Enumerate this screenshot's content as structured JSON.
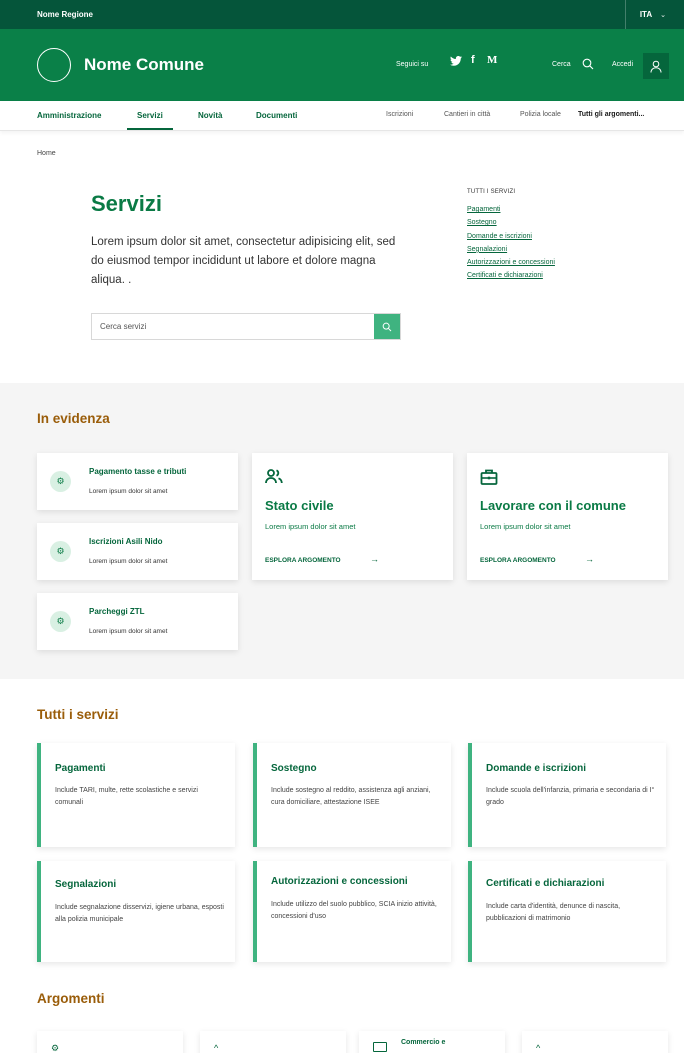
{
  "top_bar": {
    "region": "Nome Regione",
    "language": "ITA"
  },
  "header": {
    "title": "Nome Comune",
    "follow_label": "Seguici su",
    "social": [
      "twitter-icon",
      "facebook-icon",
      "medium-icon"
    ],
    "search_label": "Cerca",
    "login_label": "Accedi"
  },
  "nav": {
    "main": [
      "Amministrazione",
      "Servizi",
      "Novità",
      "Documenti"
    ],
    "active": "Servizi",
    "secondary": [
      "Iscrizioni",
      "Cantieri in città",
      "Polizia locale"
    ],
    "all_topics": "Tutti gli argomenti..."
  },
  "breadcrumb": {
    "home": "Home"
  },
  "hero": {
    "title": "Servizi",
    "description": "Lorem ipsum dolor sit amet, consectetur adipisicing elit, sed do eiusmod tempor incididunt ut labore et dolore magna aliqua. .",
    "search_placeholder": "Cerca servizi"
  },
  "side_menu": {
    "heading": "TUTTI I SERVIZI",
    "links": [
      "Pagamenti",
      "Sostegno",
      "Domande e iscrizioni",
      "Segnalazioni",
      "Autorizzazioni e concessioni",
      "Certificati e dichiarazioni"
    ]
  },
  "highlights": {
    "title": "In evidenza",
    "small_cards": [
      {
        "title": "Pagamento tasse e tributi",
        "desc": "Lorem ipsum dolor sit amet"
      },
      {
        "title": "Iscrizioni Asili Nido",
        "desc": "Lorem ipsum dolor sit amet"
      },
      {
        "title": "Parcheggi ZTL",
        "desc": "Lorem ipsum dolor sit amet"
      }
    ],
    "big_cards": [
      {
        "title": "Stato civile",
        "desc": "Lorem ipsum dolor sit amet",
        "link": "ESPLORA ARGOMENTO",
        "icon": "people-icon"
      },
      {
        "title": "Lavorare con il comune",
        "desc": "Lorem ipsum dolor sit amet",
        "link": "ESPLORA ARGOMENTO",
        "icon": "briefcase-icon"
      }
    ]
  },
  "all_services": {
    "title": "Tutti i servizi",
    "cards": [
      {
        "title": "Pagamenti",
        "desc": "Include TARI, multe, rette scolastiche e servizi comunali"
      },
      {
        "title": "Sostegno",
        "desc": "Include sostegno al reddito, assistenza agli anziani, cura domiciliare, attestazione ISEE"
      },
      {
        "title": "Domande e iscrizioni",
        "desc": "Include scuola dell'infanzia, primaria e secondaria di I° grado"
      },
      {
        "title": "Segnalazioni",
        "desc": "Include segnalazione disservizi, igiene urbana, esposti alla polizia municipale"
      },
      {
        "title": "Autorizzazioni e concessioni",
        "desc": "Include utilizzo del suolo pubblico, SCIA inizio attività, concessioni d'uso"
      },
      {
        "title": "Certificati e dichiarazioni",
        "desc": "Include carta d'identità, denunce di nascita, pubblicazioni di matrimonio"
      }
    ]
  },
  "topics": {
    "title": "Argomenti",
    "cards": [
      {
        "title": ""
      },
      {
        "title": ""
      },
      {
        "title": "Commercio e"
      },
      {
        "title": ""
      }
    ]
  },
  "colors": {
    "primary_dark": "#05553a",
    "primary": "#0a8048",
    "accent": "#3fb380",
    "section_title": "#9a5d0a"
  }
}
